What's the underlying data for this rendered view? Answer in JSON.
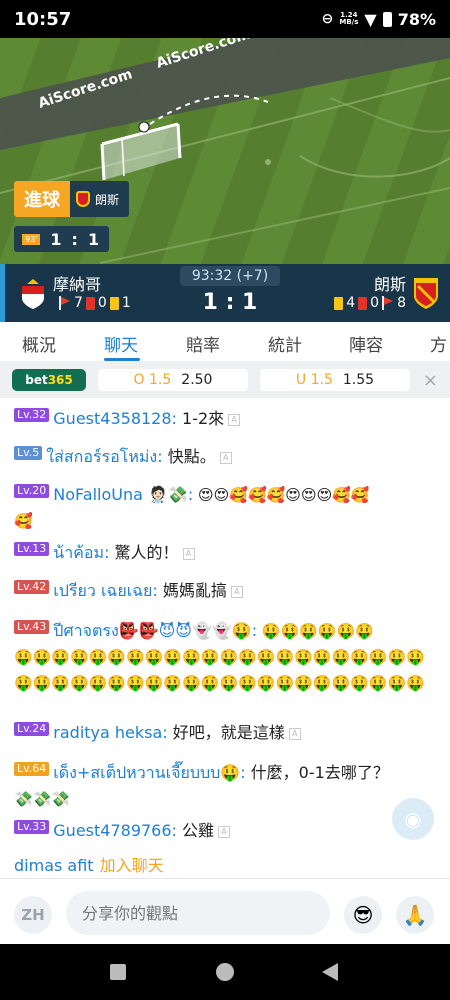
{
  "status_bar": {
    "time": "10:57",
    "net_speed": "1.24",
    "net_unit": "MB/s",
    "battery": "78%"
  },
  "pitch": {
    "watermark": "AiScore.com",
    "event_label": "進球",
    "event_team": "朗斯",
    "score_box": {
      "minute": "93'",
      "home": "1",
      "sep": ":",
      "away": "1"
    }
  },
  "match": {
    "home": {
      "name": "摩納哥",
      "corners": "7",
      "red": "0",
      "yellow": "1"
    },
    "away": {
      "name": "朗斯",
      "corners": "8",
      "red": "0",
      "yellow": "4"
    },
    "clock": "93:32 (+7)",
    "score": "1 : 1"
  },
  "tabs": [
    "概況",
    "聊天",
    "賠率",
    "統計",
    "陣容",
    "方"
  ],
  "active_tab": "聊天",
  "odds": {
    "bookmaker": {
      "text": "bet",
      "num": "365"
    },
    "over_label": "O 1.5",
    "over_value": "2.50",
    "under_label": "U 1.5",
    "under_value": "1.55",
    "close": "×"
  },
  "chat": {
    "messages": [
      {
        "level": "Lv.32",
        "user": "Guest4358128:",
        "text": " 1-2來",
        "trans": "A"
      },
      {
        "level": "Lv.5",
        "user": "ใส่สกอร์รอโหม่ง:",
        "text": " 快點。",
        "trans": "A"
      },
      {
        "level": "Lv.20",
        "user": "NoFalloUna 🧑🏻‍⚕️💸:",
        "text": " 😍😍🥰🥰🥰😍😍😍🥰🥰",
        "text2": "🥰"
      },
      {
        "level": "Lv.13",
        "user": "น้าค้อม:",
        "text": " 驚人的！",
        "trans": "A"
      },
      {
        "level": "Lv.42",
        "user": "เปรียว เฉยเฉย:",
        "text": " 媽媽亂搞",
        "trans": "A"
      },
      {
        "level": "Lv.43",
        "user": "ปีศาจตรง👺👺😈😈👻👻🤑:",
        "text": " 🤑🤑🤑🤑🤑🤑",
        "text2": "🤑🤑🤑🤑🤑🤑🤑🤑🤑🤑🤑🤑🤑🤑🤑🤑🤑🤑🤑🤑🤑🤑🤑🤑🤑🤑🤑🤑🤑🤑🤑🤑🤑🤑🤑🤑🤑🤑🤑🤑🤑🤑🤑🤑"
      },
      {
        "level": "Lv.24",
        "user": "raditya heksa:",
        "text": " 好吧，就是這樣",
        "trans": "A"
      },
      {
        "level": "Lv.64",
        "user": "เด็ง+สเต็ปหวานเจี๊ยบบบ🤑:",
        "text": " 什麼，0-1去哪了？",
        "text2": "💸💸💸"
      },
      {
        "level": "Lv.33",
        "user": "Guest4789766:",
        "text": " 公雞",
        "trans": "A"
      }
    ],
    "join": {
      "name": "dimas afit",
      "action": "加入聊天"
    }
  },
  "input_bar": {
    "lang": "ZH",
    "placeholder": "分享你的觀點",
    "emoji1": "😎",
    "emoji2": "🙏"
  }
}
